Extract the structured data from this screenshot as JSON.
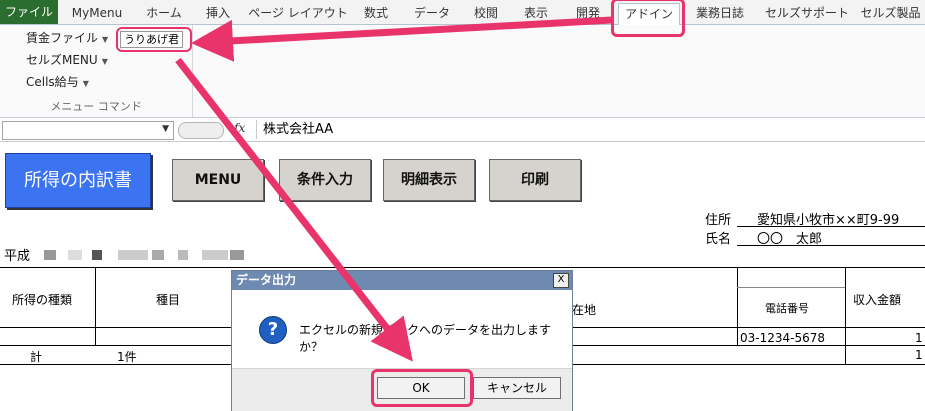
{
  "ribbon_tabs": [
    "ファイル",
    "MyMenu",
    "ホーム",
    "挿入",
    "ページ レイアウト",
    "数式",
    "データ",
    "校閲",
    "表示",
    "開発",
    "アドイン",
    "業務日誌",
    "セルズサポート",
    "セルズ製品"
  ],
  "ribbon": {
    "items": [
      "賃金ファイル",
      "セルズMENU",
      "Cells給与"
    ],
    "group_label": "メニュー コマンド",
    "addin_button": "うりあげ君"
  },
  "formula_bar": {
    "fx": "fx",
    "value": "株式会社AA"
  },
  "sheet": {
    "title_button": "所得の内訳書",
    "buttons": [
      "MENU",
      "条件入力",
      "明細表示",
      "印刷"
    ],
    "address_label": "住所",
    "address_value": "愛知県小牧市××町9-99",
    "name_label": "氏名",
    "name_value": "〇〇　太郎",
    "era": "平成",
    "headers": [
      "所得の種類",
      "種目",
      "在地",
      "電話番号",
      "収入金額"
    ],
    "row1_phone": "03-1234-5678",
    "row1_amount": "1",
    "total_label": "計",
    "total_count": "1件",
    "total_amount": "1"
  },
  "dialog": {
    "title": "データ出力",
    "message": "エクセルの新規ブックへのデータを出力しますか？",
    "ok": "OK",
    "cancel": "キャンセル",
    "close": "X",
    "icon": "?"
  },
  "colors": {
    "file_tab": "#2a6d2e",
    "title_button": "#3b73f0",
    "highlight": "#e8336b",
    "dialog_title": "#6f8ab1"
  }
}
